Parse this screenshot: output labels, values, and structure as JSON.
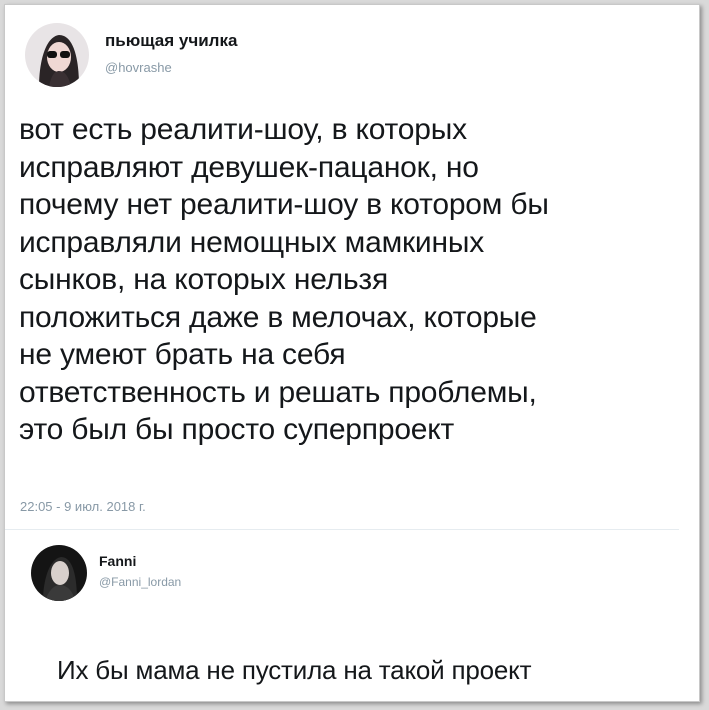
{
  "tweet": {
    "author_name": "пьющая училка",
    "author_handle": "@hovrashe",
    "text": "вот есть реалити-шоу, в которых\nисправляют девушек-пацанок, но\nпочему нет реалити-шоу в котором бы\nисправляли немощных мамкиных\nсынков, на которых нельзя\nположиться даже в мелочах, которые\nне умеют брать на себя\nответственность и решать проблемы,\nэто был бы просто суперпроект",
    "timestamp": "22:05 - 9 июл. 2018 г."
  },
  "reply": {
    "author_name": "Fanni",
    "author_handle": "@Fanni_lordan",
    "text": "Их бы мама не пустила на такой проект"
  }
}
